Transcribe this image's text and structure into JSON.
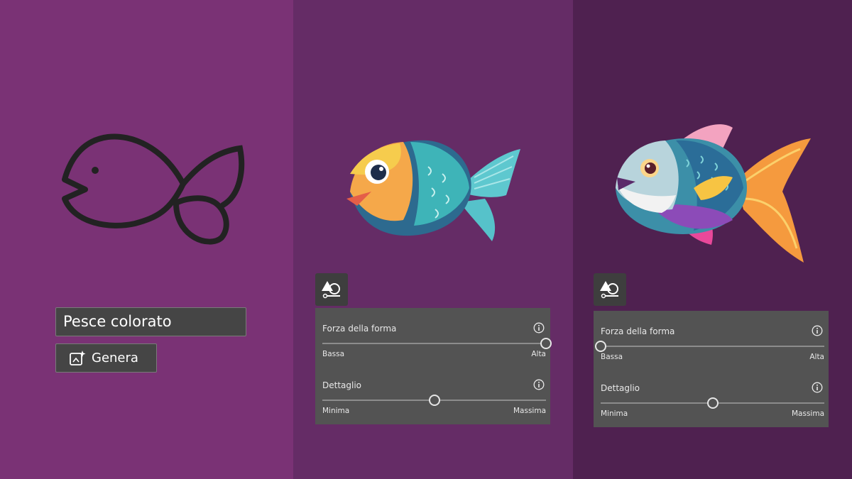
{
  "colors": {
    "panel_left": "#7a3275",
    "panel_middle": "#652c66",
    "panel_right": "#4f2150"
  },
  "prompt": {
    "value": "Pesce colorato"
  },
  "generate_button": {
    "label": "Genera",
    "icon": "sparkle-image-icon"
  },
  "panels": [
    {
      "shape_strength": {
        "label": "Forza della forma",
        "min_label": "Bassa",
        "max_label": "Alta",
        "value": 1.0
      },
      "detail": {
        "label": "Dettaglio",
        "min_label": "Minima",
        "max_label": "Massima",
        "value": 0.5
      }
    },
    {
      "shape_strength": {
        "label": "Forza della forma",
        "min_label": "Bassa",
        "max_label": "Alta",
        "value": 0.0
      },
      "detail": {
        "label": "Dettaglio",
        "min_label": "Minima",
        "max_label": "Massima",
        "value": 0.5
      }
    }
  ]
}
